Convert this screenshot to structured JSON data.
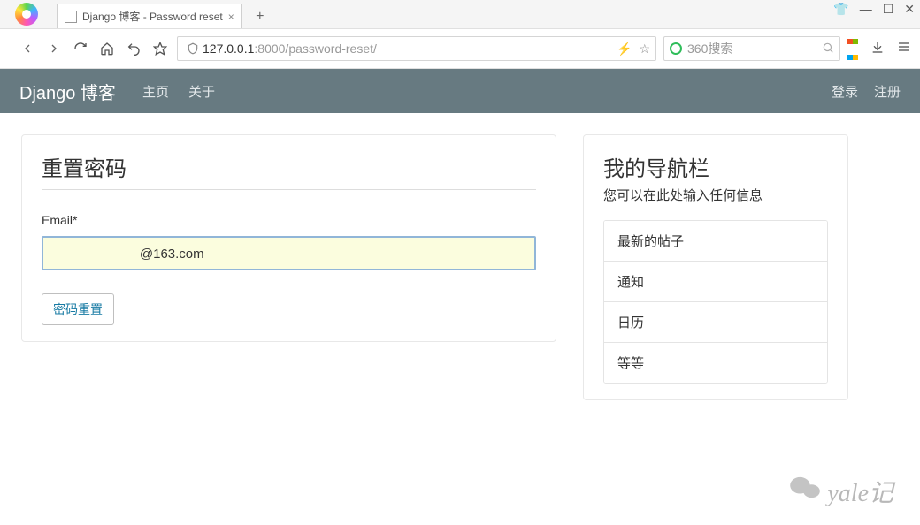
{
  "browser": {
    "tab_title": "Django 博客 - Password reset",
    "url_plain": "127.0.0.1",
    "url_gray": ":8000/password-reset/",
    "search_placeholder": "360搜索"
  },
  "nav": {
    "brand": "Django 博客",
    "links": [
      "主页",
      "关于"
    ],
    "right": [
      "登录",
      "注册"
    ]
  },
  "form": {
    "title": "重置密码",
    "email_label": "Email*",
    "email_value": "⠀⠀⠀⠀⠀⠀⠀⠀⠀@163.com",
    "submit_label": "密码重置"
  },
  "sidebar": {
    "title": "我的导航栏",
    "subtitle": "您可以在此处输入任何信息",
    "items": [
      "最新的帖子",
      "通知",
      "日历",
      "等等"
    ]
  },
  "watermark": "yale记"
}
